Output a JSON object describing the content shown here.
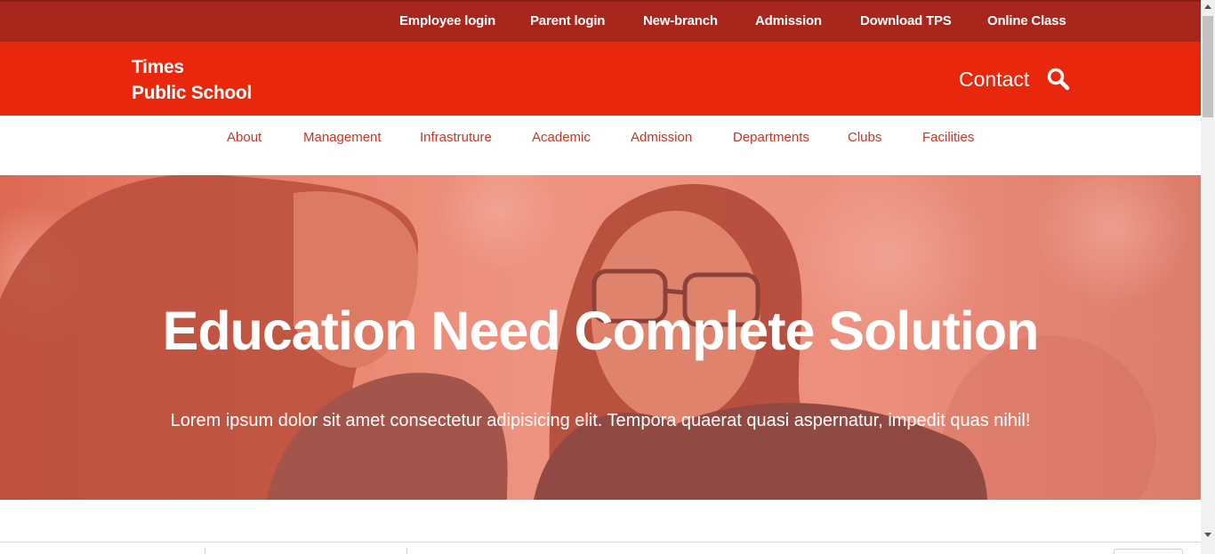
{
  "topbar": {
    "links": [
      "Employee login",
      "Parent login",
      "New-branch",
      "Admission",
      "Download TPS",
      "Online Class"
    ]
  },
  "header": {
    "brand_line1": "Times",
    "brand_line2": "Public School",
    "contact_label": "Contact",
    "search_icon": "search-icon"
  },
  "nav": {
    "items": [
      "About",
      "Management",
      "Infrastruture",
      "Academic",
      "Admission",
      "Departments",
      "Clubs",
      "Facilities"
    ]
  },
  "hero": {
    "title": "Education Need Complete Solution",
    "subtitle": "Lorem ipsum dolor sit amet consectetur adipisicing elit. Tempora quaerat quasi aspernatur, impedit quas nihil!"
  },
  "colors": {
    "topbar": "#a8261c",
    "header": "#e8270d",
    "nav_text": "#d0331f",
    "hero_overlay": "#e8735f"
  }
}
